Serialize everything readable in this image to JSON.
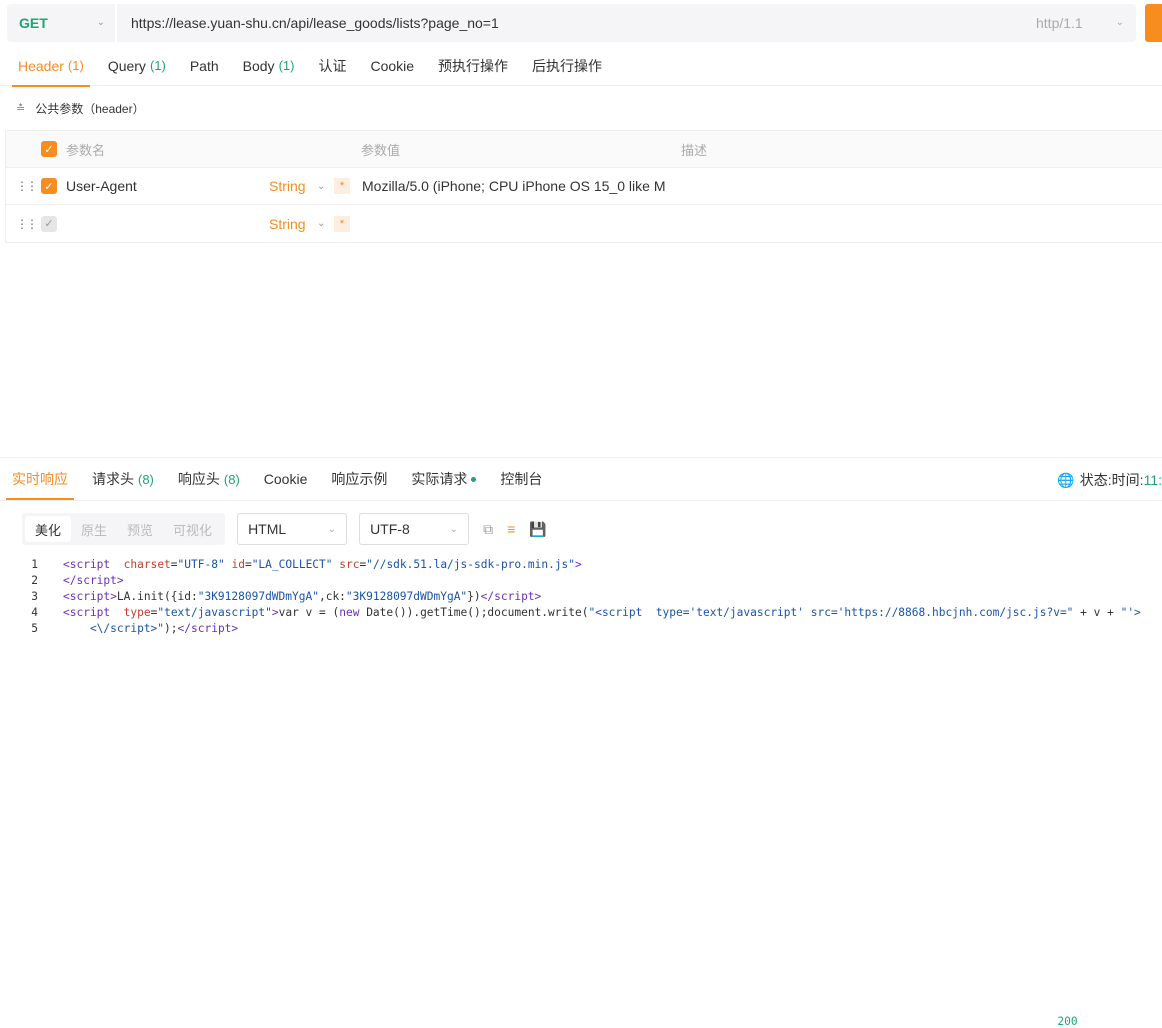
{
  "request": {
    "method": "GET",
    "url": "https://lease.yuan-shu.cn/api/lease_goods/lists?page_no=1",
    "protocol": "http/1.1"
  },
  "request_tabs": [
    {
      "label": "Header",
      "count": "(1)"
    },
    {
      "label": "Query",
      "count": "(1)"
    },
    {
      "label": "Path",
      "count": ""
    },
    {
      "label": "Body",
      "count": "(1)"
    },
    {
      "label": "认证",
      "count": ""
    },
    {
      "label": "Cookie",
      "count": ""
    },
    {
      "label": "预执行操作",
      "count": ""
    },
    {
      "label": "后执行操作",
      "count": ""
    }
  ],
  "section_label": "公共参数（header）",
  "param_table": {
    "columns": {
      "name": "参数名",
      "value": "参数值",
      "desc": "描述"
    },
    "rows": [
      {
        "name": "User-Agent",
        "type": "String",
        "value": "Mozilla/5.0 (iPhone; CPU iPhone OS 15_0 like M",
        "checked": true
      },
      {
        "name": "",
        "type": "String",
        "value": "",
        "checked": false
      }
    ]
  },
  "response_tabs": [
    {
      "label": "实时响应",
      "count": ""
    },
    {
      "label": "请求头",
      "count": "(8)"
    },
    {
      "label": "响应头",
      "count": "(8)"
    },
    {
      "label": "Cookie",
      "count": ""
    },
    {
      "label": "响应示例",
      "count": ""
    },
    {
      "label": "实际请求",
      "count": ""
    },
    {
      "label": "控制台",
      "count": ""
    }
  ],
  "status": {
    "status_label": "状态:",
    "code": "200",
    "time_label": "时间:",
    "time": "11:"
  },
  "view_modes": [
    "美化",
    "原生",
    "预览",
    "可视化"
  ],
  "format_select": "HTML",
  "encoding_select": "UTF-8",
  "code_line_numbers": [
    "1",
    "2",
    "3",
    "4",
    "5"
  ],
  "colors": {
    "accent": "#f78c1f",
    "success": "#1ea672"
  }
}
